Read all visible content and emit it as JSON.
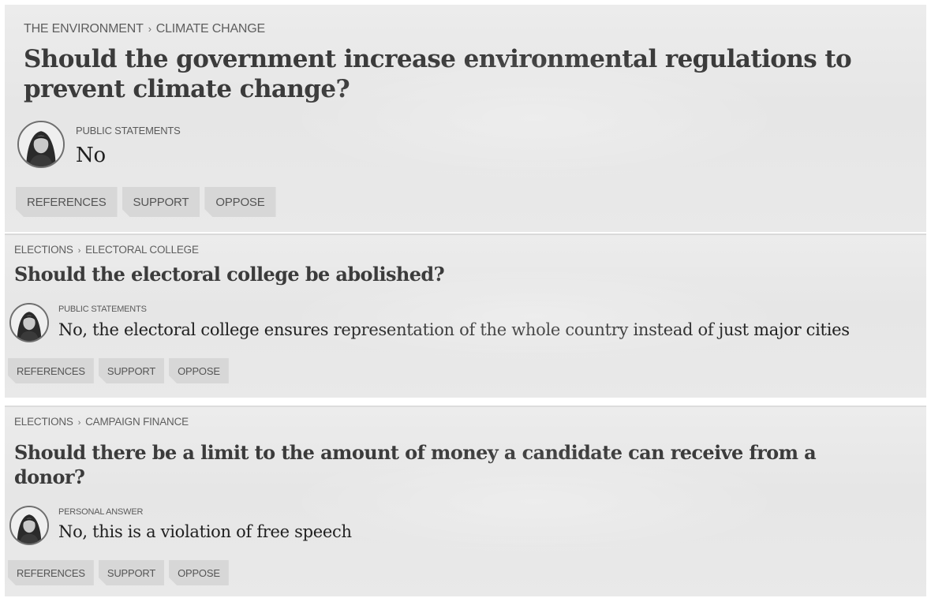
{
  "cards": [
    {
      "breadcrumb": {
        "category": "THE ENVIRONMENT",
        "separator": "›",
        "topic": "CLIMATE CHANGE"
      },
      "question": "Should the government increase environmental regulations to prevent climate change?",
      "statement_type": "PUBLIC STATEMENTS",
      "answer": "No",
      "buttons": {
        "references": "REFERENCES",
        "support": "SUPPORT",
        "oppose": "OPPOSE"
      }
    },
    {
      "breadcrumb": {
        "category": "ELECTIONS",
        "separator": "›",
        "topic": "ELECTORAL COLLEGE"
      },
      "question": "Should the electoral college be abolished?",
      "statement_type": "PUBLIC STATEMENTS",
      "answer": "No, the electoral college ensures representation of the whole country instead of just major cities",
      "buttons": {
        "references": "REFERENCES",
        "support": "SUPPORT",
        "oppose": "OPPOSE"
      }
    },
    {
      "breadcrumb": {
        "category": "ELECTIONS",
        "separator": "›",
        "topic": "CAMPAIGN FINANCE"
      },
      "question": "Should there be a limit to the amount of money a candidate can receive from a donor?",
      "statement_type": "PERSONAL ANSWER",
      "answer": "No, this is a violation of free speech",
      "buttons": {
        "references": "REFERENCES",
        "support": "SUPPORT",
        "oppose": "OPPOSE"
      }
    }
  ],
  "colors": {
    "card_background": "#e8e8e8",
    "button_background": "#d7d7d7",
    "question_text": "#3b3b3b",
    "answer_text": "#1f1f1f",
    "meta_text": "#5e5e5e"
  },
  "icons": {
    "avatar": "candidate-avatar"
  }
}
